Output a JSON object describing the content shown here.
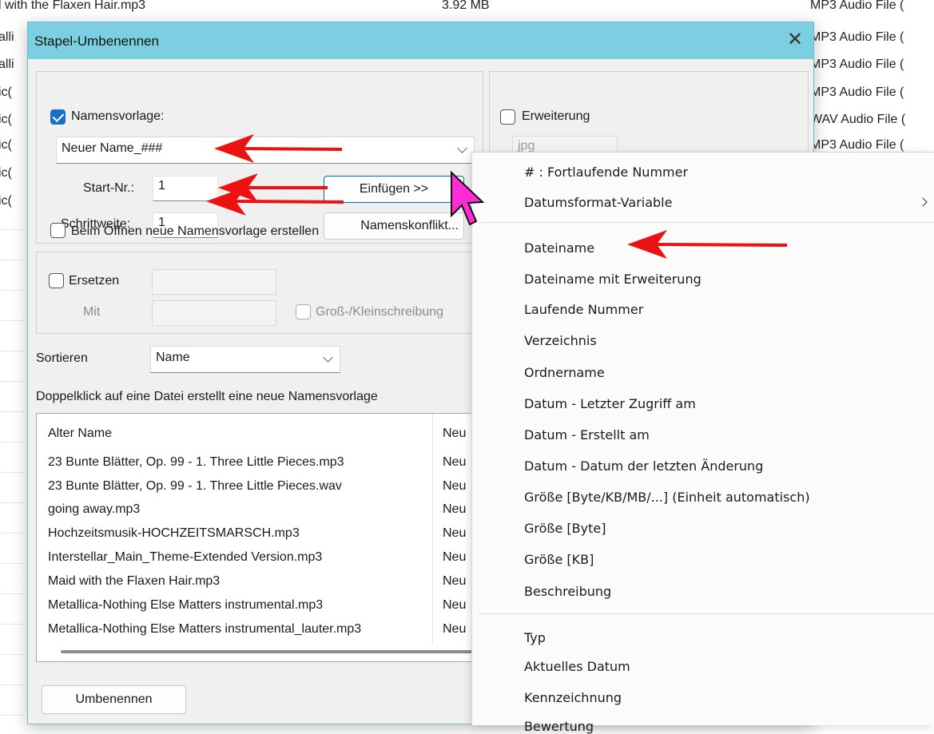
{
  "background_list": {
    "rows": [
      {
        "name": "l with the Flaxen Hair.mp3",
        "size": "3.92 MB",
        "type": "MP3 Audio File ("
      },
      {
        "name": "alli",
        "size": "",
        "type": "MP3 Audio File ("
      },
      {
        "name": "alli",
        "size": "",
        "type": "MP3 Audio File ("
      },
      {
        "name": "ic(",
        "size": "",
        "type": "MP3 Audio File ("
      },
      {
        "name": "ic(",
        "size": "",
        "type": "WAV Audio File ("
      },
      {
        "name": "ic(",
        "size": "",
        "type": "MP3 Audio File ("
      },
      {
        "name": "ic(",
        "size": "",
        "type": ""
      },
      {
        "name": "ic(",
        "size": "",
        "type": ""
      }
    ]
  },
  "dialog": {
    "title": "Stapel-Umbenennen",
    "close_symbol": "✕",
    "name_template": {
      "checkbox_label": "Namensvorlage:",
      "checked": true,
      "value": "Neuer Name_###",
      "start_label": "Start-Nr.:",
      "start_value": "1",
      "step_label": "Schrittweite:",
      "step_value": "1",
      "insert_button": "Einfügen >>",
      "conflict_button": "Namenskonflikt...",
      "on_open_label": "Beim Öffnen neue Namensvorlage erstellen"
    },
    "extension": {
      "checkbox_label": "Erweiterung",
      "value": "jpg"
    },
    "replace": {
      "checkbox_label": "Ersetzen",
      "with_label": "Mit",
      "case_label": "Groß-/Kleinschreibung"
    },
    "sort": {
      "label": "Sortieren",
      "value": "Name"
    },
    "hint": "Doppelklick auf eine Datei erstellt eine neue Namensvorlage",
    "list": {
      "col_old": "Alter Name",
      "col_new": "Neu",
      "rows": [
        {
          "old": "23 Bunte Blätter, Op. 99 - 1. Three Little Pieces.mp3",
          "new": "Neu"
        },
        {
          "old": "23 Bunte Blätter, Op. 99 - 1. Three Little Pieces.wav",
          "new": "Neu"
        },
        {
          "old": "going away.mp3",
          "new": "Neu"
        },
        {
          "old": "Hochzeitsmusik-HOCHZEITSMARSCH.mp3",
          "new": "Neu"
        },
        {
          "old": "Interstellar_Main_Theme-Extended Version.mp3",
          "new": "Neu"
        },
        {
          "old": "Maid with the Flaxen Hair.mp3",
          "new": "Neu"
        },
        {
          "old": "Metallica-Nothing Else Matters instrumental.mp3",
          "new": "Neu"
        },
        {
          "old": "Metallica-Nothing Else Matters instrumental_lauter.mp3",
          "new": "Neu"
        }
      ]
    },
    "rename_button": "Umbenennen"
  },
  "context_menu": {
    "items": [
      {
        "label": "# : Fortlaufende Nummer",
        "submenu": false
      },
      {
        "label": "Datumsformat-Variable",
        "submenu": true
      },
      {
        "separator": true
      },
      {
        "label": "Dateiname",
        "submenu": false
      },
      {
        "label": "Dateiname mit Erweiterung",
        "submenu": false
      },
      {
        "label": "Laufende Nummer",
        "submenu": false
      },
      {
        "label": "Verzeichnis",
        "submenu": false
      },
      {
        "label": "Ordnername",
        "submenu": false
      },
      {
        "label": "Datum - Letzter Zugriff am",
        "submenu": false
      },
      {
        "label": "Datum - Erstellt am",
        "submenu": false
      },
      {
        "label": "Datum - Datum der letzten Änderung",
        "submenu": false
      },
      {
        "label": "Größe [Byte/KB/MB/...] (Einheit automatisch)",
        "submenu": false
      },
      {
        "label": "Größe [Byte]",
        "submenu": false
      },
      {
        "label": "Größe [KB]",
        "submenu": false
      },
      {
        "label": "Beschreibung",
        "submenu": false
      },
      {
        "separator": true
      },
      {
        "label": "Typ",
        "submenu": false
      },
      {
        "label": "Aktuelles Datum",
        "submenu": false
      },
      {
        "label": "Kennzeichnung",
        "submenu": false
      },
      {
        "label": "Bewertung",
        "submenu": false
      }
    ]
  },
  "colors": {
    "titlebar": "#7ccfe0",
    "checkbox_checked": "#1a6fc9",
    "annotation_arrow": "#ee1111",
    "cursor": "#ff2bd6"
  },
  "icons": [
    "close-icon",
    "checkmark-icon",
    "chevron-down-icon",
    "chevron-right-icon",
    "arrow-annotation-icon",
    "mouse-cursor-icon"
  ]
}
